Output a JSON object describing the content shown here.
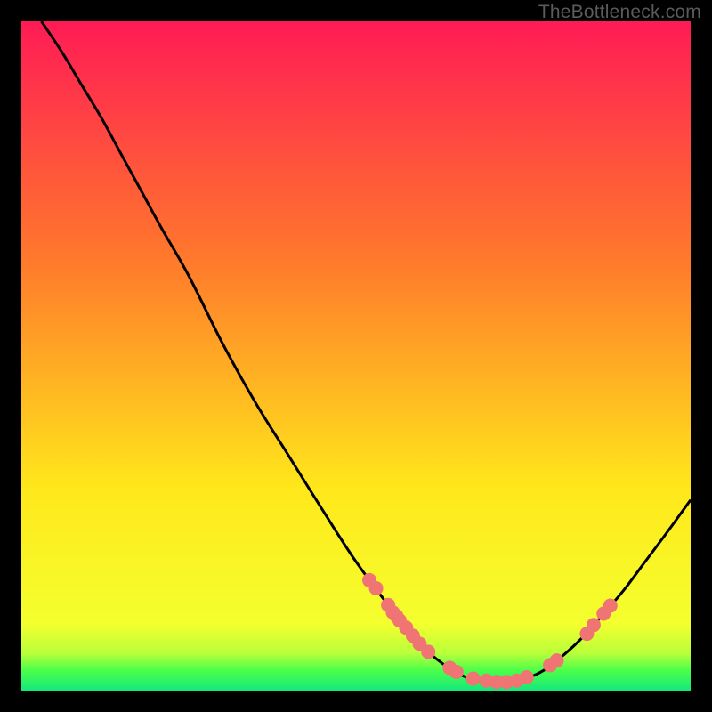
{
  "watermark": "TheBottleneck.com",
  "chart_data": {
    "type": "line",
    "title": "",
    "xlabel": "",
    "ylabel": "",
    "xlim": [
      0,
      100
    ],
    "ylim": [
      0,
      100
    ],
    "gradient_colors": {
      "top": "#ff1b55",
      "mid_upper": "#ff7a2b",
      "mid_lower": "#ffe81b",
      "green_light": "#b7ff3a",
      "green_mid": "#4aff4a",
      "green_dark": "#14e87c"
    },
    "curve": [
      {
        "x": 3.0,
        "y": 100.0
      },
      {
        "x": 6.0,
        "y": 95.5
      },
      {
        "x": 9.0,
        "y": 90.5
      },
      {
        "x": 12.0,
        "y": 85.5
      },
      {
        "x": 15.0,
        "y": 80.0
      },
      {
        "x": 18.0,
        "y": 74.5
      },
      {
        "x": 21.0,
        "y": 69.0
      },
      {
        "x": 25.0,
        "y": 62.0
      },
      {
        "x": 30.0,
        "y": 52.0
      },
      {
        "x": 35.0,
        "y": 43.0
      },
      {
        "x": 40.0,
        "y": 35.0
      },
      {
        "x": 45.0,
        "y": 27.0
      },
      {
        "x": 49.5,
        "y": 20.0
      },
      {
        "x": 53.5,
        "y": 14.5
      },
      {
        "x": 57.0,
        "y": 10.0
      },
      {
        "x": 60.0,
        "y": 6.5
      },
      {
        "x": 63.0,
        "y": 4.0
      },
      {
        "x": 66.0,
        "y": 2.2
      },
      {
        "x": 69.0,
        "y": 1.4
      },
      {
        "x": 72.0,
        "y": 1.3
      },
      {
        "x": 75.0,
        "y": 1.7
      },
      {
        "x": 78.0,
        "y": 3.0
      },
      {
        "x": 81.0,
        "y": 5.3
      },
      {
        "x": 84.0,
        "y": 8.1
      },
      {
        "x": 87.0,
        "y": 11.5
      },
      {
        "x": 90.0,
        "y": 15.0
      },
      {
        "x": 93.0,
        "y": 19.0
      },
      {
        "x": 96.0,
        "y": 23.0
      },
      {
        "x": 100.0,
        "y": 28.5
      }
    ],
    "points": [
      {
        "x": 52.0,
        "y": 16.5
      },
      {
        "x": 53.0,
        "y": 15.3
      },
      {
        "x": 54.8,
        "y": 12.8
      },
      {
        "x": 55.5,
        "y": 11.7
      },
      {
        "x": 56.0,
        "y": 11.2
      },
      {
        "x": 56.5,
        "y": 10.5
      },
      {
        "x": 57.5,
        "y": 9.4
      },
      {
        "x": 58.5,
        "y": 8.2
      },
      {
        "x": 59.5,
        "y": 7.0
      },
      {
        "x": 60.8,
        "y": 5.8
      },
      {
        "x": 64.0,
        "y": 3.4
      },
      {
        "x": 65.0,
        "y": 2.8
      },
      {
        "x": 67.5,
        "y": 1.8
      },
      {
        "x": 69.5,
        "y": 1.5
      },
      {
        "x": 71.0,
        "y": 1.3
      },
      {
        "x": 72.5,
        "y": 1.3
      },
      {
        "x": 74.0,
        "y": 1.5
      },
      {
        "x": 75.5,
        "y": 2.0
      },
      {
        "x": 79.0,
        "y": 3.8
      },
      {
        "x": 80.0,
        "y": 4.5
      },
      {
        "x": 84.5,
        "y": 8.5
      },
      {
        "x": 85.5,
        "y": 9.8
      },
      {
        "x": 87.0,
        "y": 11.5
      },
      {
        "x": 88.0,
        "y": 12.7
      }
    ],
    "point_color": "#f07474",
    "curve_color": "#000000"
  }
}
